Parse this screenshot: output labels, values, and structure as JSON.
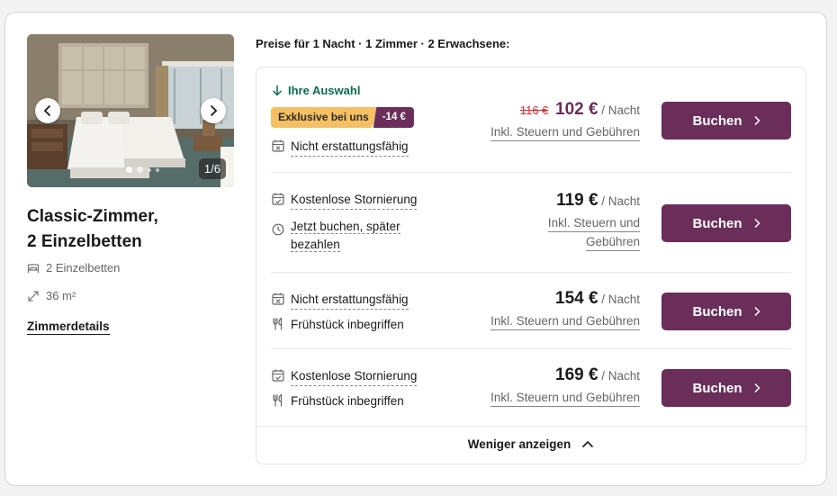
{
  "photo": {
    "counter": "1/6",
    "dots": 4,
    "active_dot": 0
  },
  "room": {
    "title": "Classic-Zimmer, 2 Einzelbetten",
    "beds": "2 Einzelbetten",
    "size": "36 m²",
    "details_link": "Zimmerdetails"
  },
  "prices_heading": "Preise für 1 Nacht · 1 Zimmer · 2 Erwachsene:",
  "rates": [
    {
      "choice": "Ihre Auswahl",
      "badge_label": "Exklusive bei uns",
      "badge_discount": "-14 €",
      "conditions": [
        {
          "icon": "calendar-x-icon",
          "text": "Nicht erstattungsfähig"
        }
      ],
      "old_price": "116 €",
      "price": "102 €",
      "per": "/ Nacht",
      "tax": "Inkl. Steuern und Gebühren",
      "button": "Buchen"
    },
    {
      "conditions": [
        {
          "icon": "calendar-check-icon",
          "text": "Kostenlose Stornierung"
        },
        {
          "icon": "clock-icon",
          "text_l1": "Jetzt buchen, später",
          "text_l2": "bezahlen"
        }
      ],
      "price": "119 €",
      "per": "/ Nacht",
      "tax_l1": "Inkl. Steuern und",
      "tax_l2": "Gebühren",
      "button": "Buchen"
    },
    {
      "conditions": [
        {
          "icon": "calendar-x-icon",
          "text": "Nicht erstattungsfähig"
        },
        {
          "icon": "cutlery-icon",
          "text": "Frühstück inbegriffen"
        }
      ],
      "price": "154 €",
      "per": "/ Nacht",
      "tax": "Inkl. Steuern und Gebühren",
      "button": "Buchen"
    },
    {
      "conditions": [
        {
          "icon": "calendar-check-icon",
          "text": "Kostenlose Stornierung"
        },
        {
          "icon": "cutlery-icon",
          "text": "Frühstück inbegriffen"
        }
      ],
      "price": "169 €",
      "per": "/ Nacht",
      "tax": "Inkl. Steuern und Gebühren",
      "button": "Buchen"
    }
  ],
  "show_less": "Weniger anzeigen",
  "colors": {
    "brand": "#6b2e5a",
    "badge": "#f5c063",
    "green": "#0d6b4f",
    "strike": "#d12a2a"
  }
}
